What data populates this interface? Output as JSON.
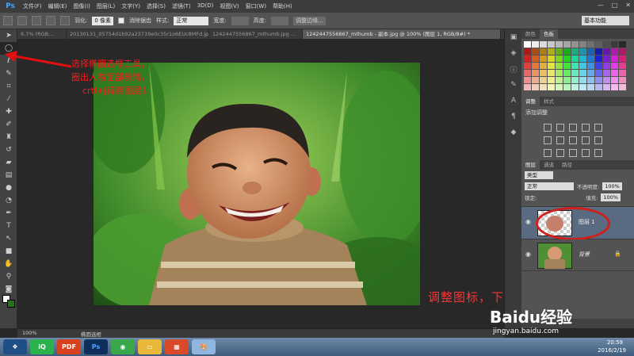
{
  "app": {
    "logo": "Ps",
    "menu": [
      "文件(F)",
      "编辑(E)",
      "图像(I)",
      "图层(L)",
      "文字(Y)",
      "选择(S)",
      "滤镜(T)",
      "3D(D)",
      "视图(V)",
      "窗口(W)",
      "帮助(H)"
    ],
    "window_controls": [
      "—",
      "□",
      "✕"
    ]
  },
  "options_bar": {
    "feather_label": "羽化:",
    "feather_value": "0 像素",
    "antialias_label": "消除锯齿",
    "style_label": "样式:",
    "style_value": "正常",
    "width_label": "宽度:",
    "height_label": "高度:",
    "refine_edge": "调整边缘...",
    "workspace": "基本功能"
  },
  "tabs": [
    {
      "label": "6.7% (RGB...",
      "active": false
    },
    {
      "label": "20130131_05754d1b92a23739e0c35r1o6EUc8MFd.jpg",
      "active": false
    },
    {
      "label": "1242447556867_mthumb.jpg ...",
      "active": false
    },
    {
      "label": "1242447556867_mthumb - 副本.jpg @ 100% (图层 1, RGB/8#) *",
      "active": true
    }
  ],
  "annotation": {
    "line1": "选择椭圆选框工具，",
    "line2": "圈出人物面部表情，",
    "line3": "crtl+J得到图层1",
    "bottom": "调整图标，下一步骤会用到"
  },
  "status": {
    "zoom": "100%",
    "tool": "椭圆选框"
  },
  "panels": {
    "color_tabs": [
      "颜色",
      "色板"
    ],
    "adjust_tabs": [
      "调整",
      "样式"
    ],
    "adjust_title": "添加调整",
    "layer_tabs": [
      "图层",
      "通道",
      "路径"
    ],
    "kind_label": "类型",
    "blend_mode": "正常",
    "opacity_label": "不透明度:",
    "opacity_value": "100%",
    "lock_label": "锁定:",
    "fill_label": "填充:",
    "fill_value": "100%",
    "layers": [
      {
        "name": "图层 1",
        "selected": true
      },
      {
        "name": "背景",
        "selected": false
      }
    ]
  },
  "taskbar": {
    "apps": [
      "iQIYI",
      "PDF",
      "Ps",
      "360",
      "folder",
      "gift",
      "paint"
    ],
    "time": "20:59",
    "date": "2016/2/19"
  },
  "watermark": {
    "brand": "Baidu经验",
    "url": "jingyan.baidu.com"
  },
  "colors": {
    "annotation_red": "#ff1a1a",
    "selected_layer": "#5a6a80",
    "ps_blue": "#4aa3ff"
  }
}
